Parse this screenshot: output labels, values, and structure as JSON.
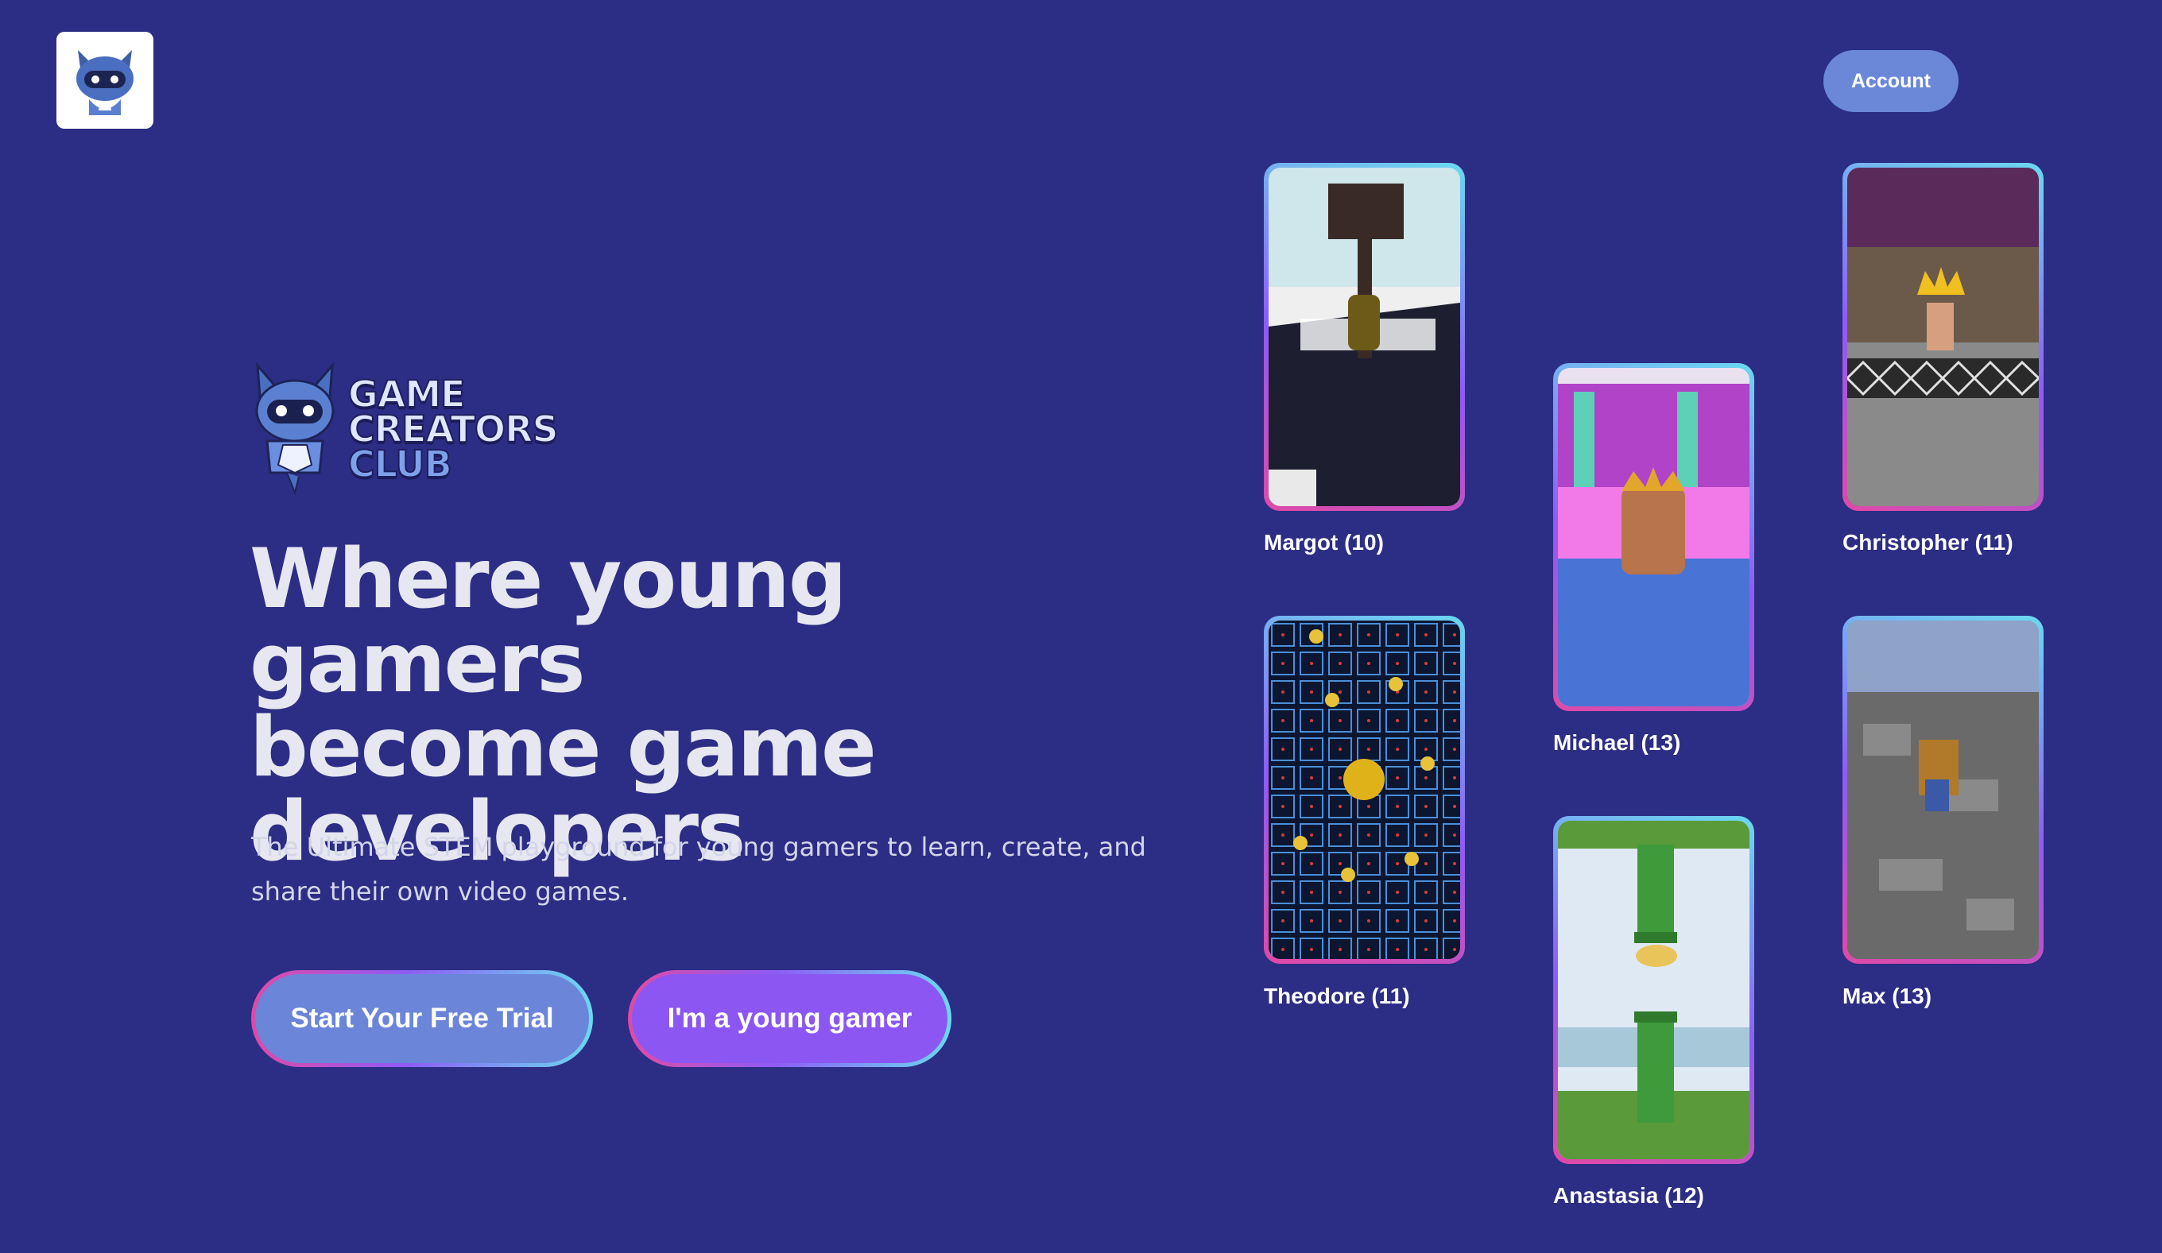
{
  "header": {
    "logo_icon": "cat-mascot-icon",
    "account_label": "Account"
  },
  "brand": {
    "line1": "GAME",
    "line2": "CREATORS",
    "line3": "CLUB"
  },
  "hero": {
    "headline_line1": "Where young gamers",
    "headline_line2": "become game",
    "headline_line3": "developers",
    "subtitle": "The Ultimate STEM playground for young gamers to learn, create, and share their own video games.",
    "cta_primary": "Start Your Free Trial",
    "cta_secondary": "I'm a young gamer"
  },
  "games": [
    {
      "caption": "Margot (10)"
    },
    {
      "caption": "Theodore (11)"
    },
    {
      "caption": "Michael (13)"
    },
    {
      "caption": "Anastasia (12)"
    },
    {
      "caption": "Christopher (11)"
    },
    {
      "caption": "Max (13)"
    }
  ],
  "colors": {
    "background": "#2c2d84",
    "accent_blue": "#6b85d8",
    "accent_purple": "#8b56f2",
    "gradient_pink": "#e04aa6",
    "gradient_cyan": "#6ad9f0"
  }
}
